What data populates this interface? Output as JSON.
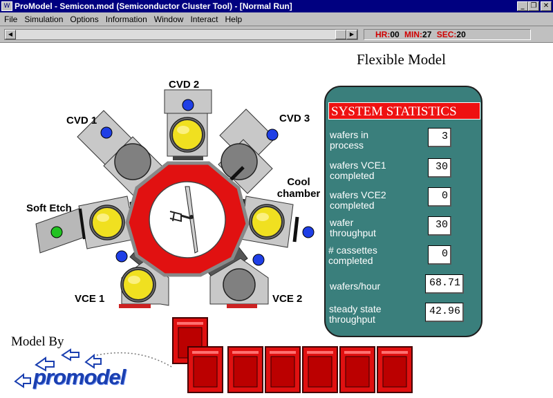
{
  "window": {
    "title": "ProModel - Semicon.mod (Semiconductor Cluster Tool) - [Normal Run]",
    "icon": "promodel-app-icon",
    "minimize_glyph": "_",
    "restore_glyph": "❐",
    "close_glyph": "✕"
  },
  "menu": [
    "File",
    "Simulation",
    "Options",
    "Information",
    "Window",
    "Interact",
    "Help"
  ],
  "clock": {
    "hr_label": "HR:",
    "hr": "00",
    "min_label": "MIN:",
    "min": "27",
    "sec_label": "SEC:",
    "sec": "20"
  },
  "model_title": "Flexible Model",
  "stations": {
    "cvd1": "CVD 1",
    "cvd2": "CVD 2",
    "cvd3": "CVD 3",
    "cool": "Cool chamber",
    "soft_etch": "Soft Etch",
    "vce1": "VCE 1",
    "vce2": "VCE 2"
  },
  "stats": {
    "title": "SYSTEM STATISTICS",
    "rows": [
      {
        "label": "wafers in process",
        "value": "3"
      },
      {
        "label": "wafers VCE1 completed",
        "value": "30"
      },
      {
        "label": "wafers VCE2 completed",
        "value": "0"
      },
      {
        "label": "wafer throughput",
        "value": "30"
      },
      {
        "label": "# cassettes completed",
        "value": "0"
      },
      {
        "label": "wafers/hour",
        "value": "68.71"
      },
      {
        "label": "steady state throughput",
        "value": "42.96"
      }
    ]
  },
  "footer": {
    "model_by": "Model By",
    "logo": "promodel"
  },
  "colors": {
    "title_bar": "#000080",
    "panel": "#3a7f7c",
    "stats_title": "#e11111",
    "hub_ring": "#e11111",
    "wafer": "#f0e020",
    "indicator_blue": "#1f3fe6",
    "indicator_green": "#22c322"
  }
}
